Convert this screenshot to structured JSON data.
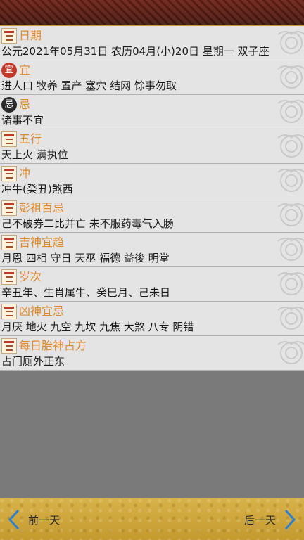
{
  "rows": [
    {
      "key": "date",
      "title": "日期",
      "icon": "book-icon",
      "body": "公元2021年05月31日 农历04月(小)20日   星期一   双子座"
    },
    {
      "key": "yi",
      "title": "宜",
      "icon": "yi-icon",
      "icon_text": "宜",
      "body": "进人口 牧养 置产 塞穴 结网 馀事勿取"
    },
    {
      "key": "ji",
      "title": "忌",
      "icon": "ji-icon",
      "icon_text": "忌",
      "body": "诸事不宜"
    },
    {
      "key": "wuxing",
      "title": "五行",
      "icon": "book-icon",
      "body": "天上火 满执位"
    },
    {
      "key": "chong",
      "title": "冲",
      "icon": "book-icon",
      "body": "冲牛(癸丑)煞西"
    },
    {
      "key": "pengzu",
      "title": "彭祖百忌",
      "icon": "book-icon",
      "body": "己不破券二比并亡 未不服药毒气入肠"
    },
    {
      "key": "jishen",
      "title": "吉神宜趋",
      "icon": "book-icon",
      "body": "月恩 四相 守日 天巫 福德 益後 明堂"
    },
    {
      "key": "suici",
      "title": "岁次",
      "icon": "book-icon",
      "body": "辛丑年、生肖属牛、癸巳月、己未日"
    },
    {
      "key": "xiongshen",
      "title": "凶神宜忌",
      "icon": "book-icon",
      "body": "月厌 地火 九空 九坎 九焦 大煞 八专 阴错"
    },
    {
      "key": "taishen",
      "title": "每日胎神占方",
      "icon": "book-icon",
      "body": "占门厕外正东"
    }
  ],
  "footer": {
    "prev_label": "前一天",
    "next_label": "后一天"
  },
  "colors": {
    "title": "#e08a2c",
    "row_bg": "#e4e4e4",
    "footer": "#c49a2e",
    "header": "#5a1e14"
  }
}
